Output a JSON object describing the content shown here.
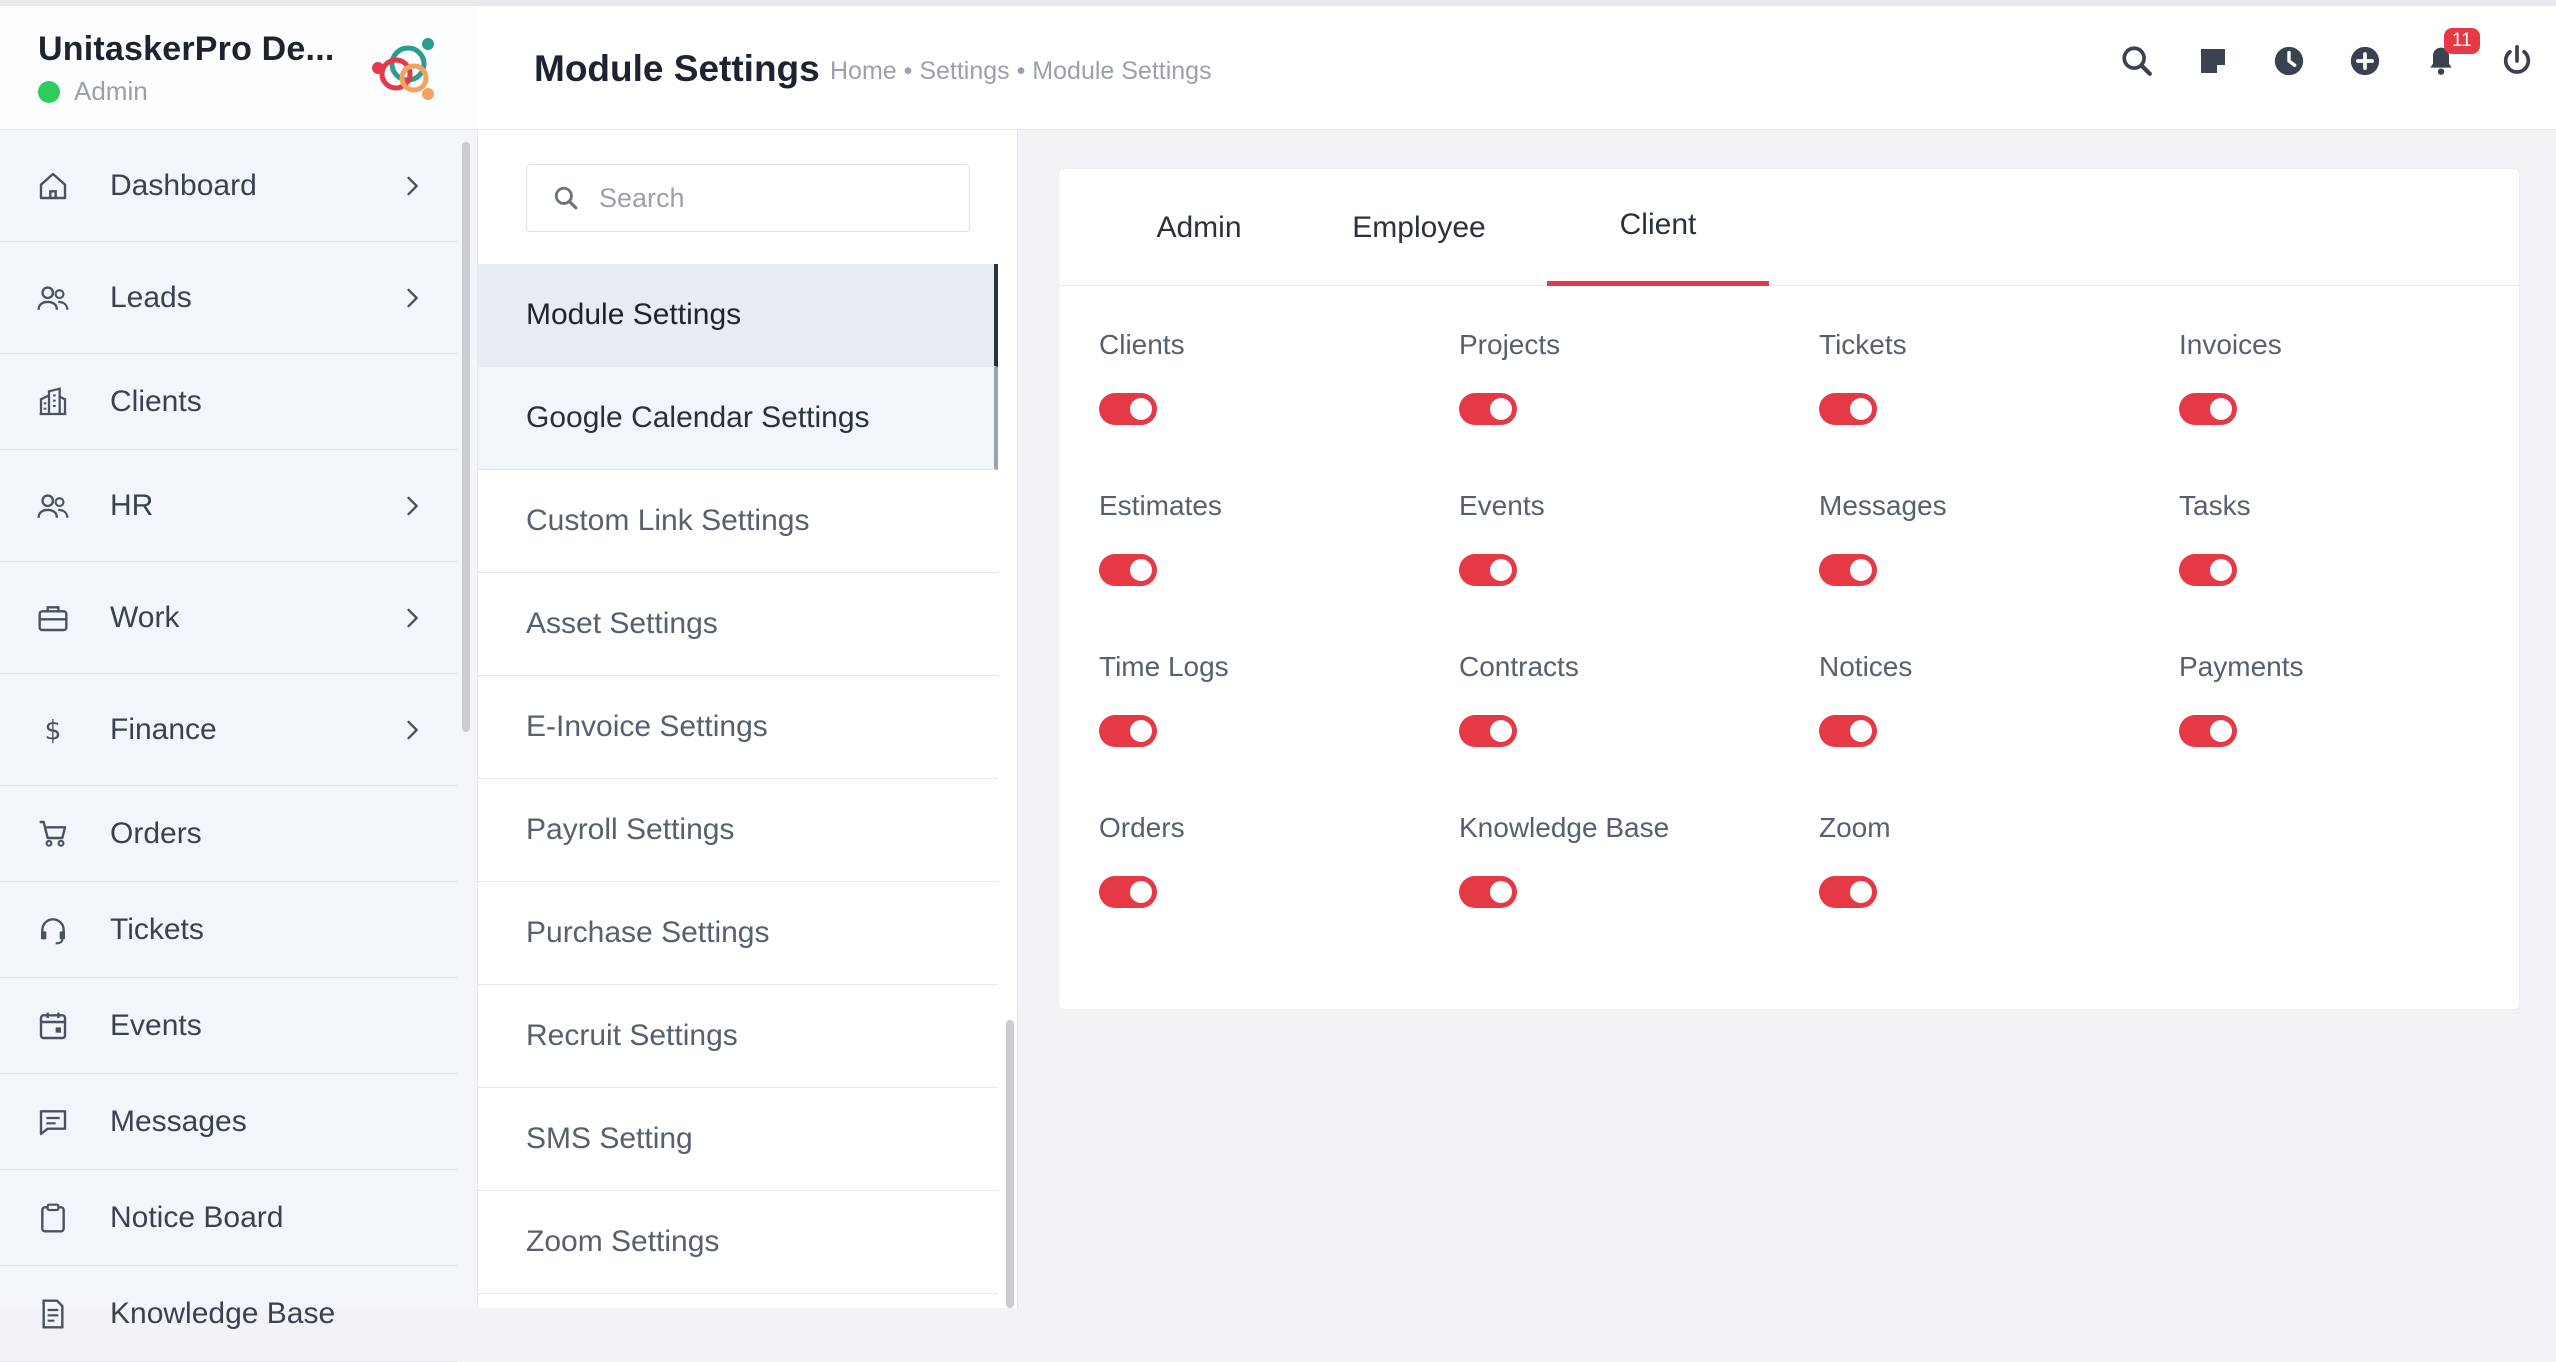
{
  "brand": {
    "name": "UnitaskerPro De...",
    "role": "Admin"
  },
  "sidebar": {
    "items": [
      {
        "label": "Dashboard",
        "icon": "home-icon",
        "has_chevron": true
      },
      {
        "label": "Leads",
        "icon": "users-icon",
        "has_chevron": true
      },
      {
        "label": "Clients",
        "icon": "building-icon",
        "has_chevron": false
      },
      {
        "label": "HR",
        "icon": "users-icon",
        "has_chevron": true
      },
      {
        "label": "Work",
        "icon": "briefcase-icon",
        "has_chevron": true
      },
      {
        "label": "Finance",
        "icon": "dollar-icon",
        "has_chevron": true
      },
      {
        "label": "Orders",
        "icon": "cart-icon",
        "has_chevron": false
      },
      {
        "label": "Tickets",
        "icon": "headset-icon",
        "has_chevron": false
      },
      {
        "label": "Events",
        "icon": "calendar-icon",
        "has_chevron": false
      },
      {
        "label": "Messages",
        "icon": "chat-icon",
        "has_chevron": false
      },
      {
        "label": "Notice Board",
        "icon": "clipboard-icon",
        "has_chevron": false
      },
      {
        "label": "Knowledge Base",
        "icon": "document-icon",
        "has_chevron": false
      }
    ]
  },
  "header": {
    "title": "Module Settings",
    "breadcrumb": "Home • Settings • Module Settings",
    "icons": [
      "search-icon",
      "sticky-note-icon",
      "clock-icon",
      "plus-circle-icon",
      "bell-icon",
      "power-icon"
    ],
    "notification_count": "11"
  },
  "settings_menu": {
    "search_placeholder": "Search",
    "items": [
      "Module Settings",
      "Google Calendar Settings",
      "Custom Link Settings",
      "Asset Settings",
      "E-Invoice Settings",
      "Payroll Settings",
      "Purchase Settings",
      "Recruit Settings",
      "SMS Setting",
      "Zoom Settings"
    ],
    "active": "Module Settings"
  },
  "main": {
    "tabs": [
      "Admin",
      "Employee",
      "Client"
    ],
    "active_tab": "Client",
    "modules": [
      {
        "label": "Clients",
        "enabled": true
      },
      {
        "label": "Projects",
        "enabled": true
      },
      {
        "label": "Tickets",
        "enabled": true
      },
      {
        "label": "Invoices",
        "enabled": true
      },
      {
        "label": "Estimates",
        "enabled": true
      },
      {
        "label": "Events",
        "enabled": true
      },
      {
        "label": "Messages",
        "enabled": true
      },
      {
        "label": "Tasks",
        "enabled": true
      },
      {
        "label": "Time Logs",
        "enabled": true
      },
      {
        "label": "Contracts",
        "enabled": true
      },
      {
        "label": "Notices",
        "enabled": true
      },
      {
        "label": "Payments",
        "enabled": true
      },
      {
        "label": "Orders",
        "enabled": true
      },
      {
        "label": "Knowledge Base",
        "enabled": true
      },
      {
        "label": "Zoom",
        "enabled": true
      }
    ]
  },
  "colors": {
    "accent": "#e63946",
    "online": "#2fcc5b"
  }
}
